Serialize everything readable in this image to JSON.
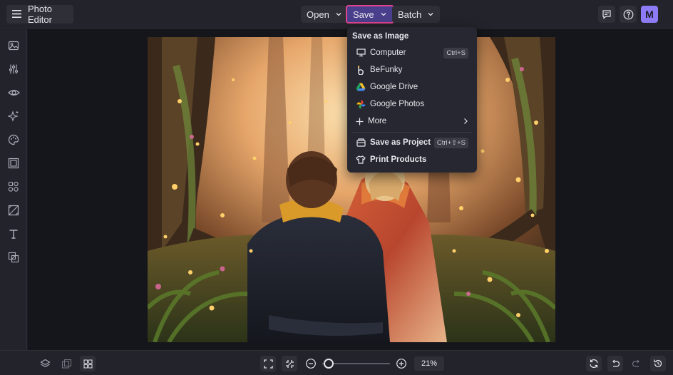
{
  "topbar": {
    "app_title": "Photo Editor",
    "menus": [
      {
        "label": "Open"
      },
      {
        "label": "Save"
      },
      {
        "label": "Batch"
      }
    ],
    "avatar_initial": "M"
  },
  "save_menu": {
    "header": "Save as Image",
    "items": [
      {
        "label": "Computer",
        "shortcut": "Ctrl+S",
        "icon": "monitor-icon"
      },
      {
        "label": "BeFunky",
        "icon": "befunky-icon"
      },
      {
        "label": "Google Drive",
        "icon": "google-drive-icon"
      },
      {
        "label": "Google Photos",
        "icon": "google-photos-icon"
      },
      {
        "label": "More",
        "icon": "plus-icon"
      },
      {
        "label": "Save as Project",
        "shortcut": "Ctrl+⇧+S",
        "icon": "project-icon"
      },
      {
        "label": "Print Products",
        "icon": "tshirt-icon"
      }
    ]
  },
  "sidebar": {
    "icons": [
      "image-icon",
      "adjust-sliders-icon",
      "eye-icon",
      "effects-sparkle-icon",
      "palette-icon",
      "frame-icon",
      "graphics-icon",
      "texture-icon",
      "text-icon",
      "overlay-icon"
    ]
  },
  "bottombar": {
    "zoom": "21%",
    "zoom_level": 0.05
  },
  "colors": {
    "accent": "#e0448d",
    "save_button": "#4a3f8c",
    "avatar": "#8b7cf6",
    "background": "#1b1c22",
    "panel": "#23242b"
  }
}
